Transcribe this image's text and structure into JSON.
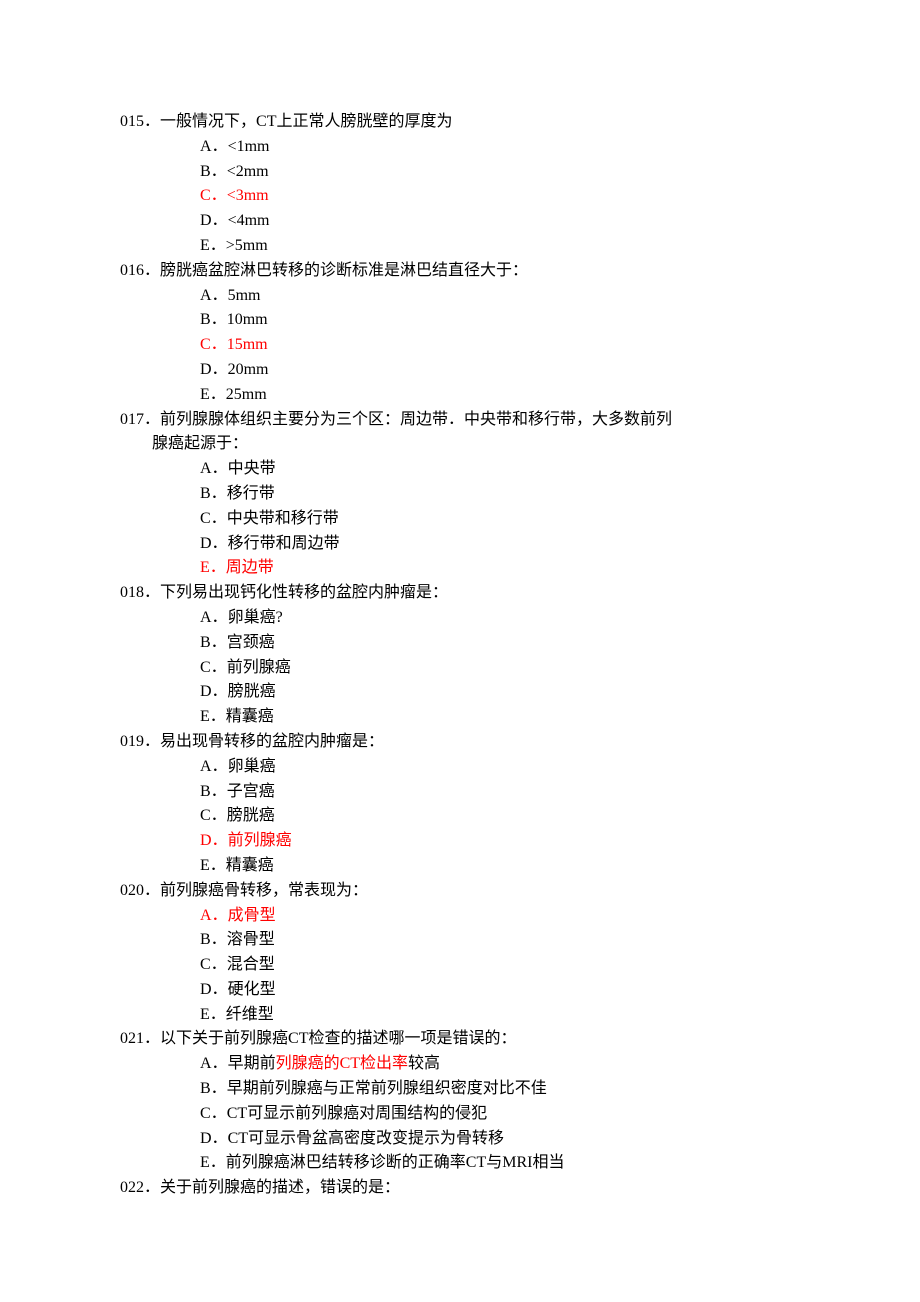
{
  "questions": [
    {
      "num": "015．",
      "text": "一般情况下，CT上正常人膀胱壁的厚度为",
      "options": [
        {
          "label": "A．",
          "text": "<1mm",
          "answer": false
        },
        {
          "label": "B．",
          "text": "<2mm",
          "answer": false
        },
        {
          "label": "C．",
          "text": "<3mm",
          "answer": true
        },
        {
          "label": "D．",
          "text": "<4mm",
          "answer": false
        },
        {
          "label": "E．",
          "text": ">5mm",
          "answer": false
        }
      ]
    },
    {
      "num": "016．",
      "text": "膀胱癌盆腔淋巴转移的诊断标准是淋巴结直径大于：",
      "options": [
        {
          "label": "A．",
          "text": "5mm",
          "answer": false
        },
        {
          "label": "B．",
          "text": "10mm",
          "answer": false
        },
        {
          "label": "C．",
          "text": "15mm",
          "answer": true
        },
        {
          "label": "D．",
          "text": "20mm",
          "answer": false
        },
        {
          "label": "E．",
          "text": "25mm",
          "answer": false
        }
      ]
    },
    {
      "num": "017．",
      "text": "前列腺腺体组织主要分为三个区：周边带．中央带和移行带，大多数前列",
      "text_cont": "腺癌起源于：",
      "options": [
        {
          "label": "A．",
          "text": "中央带",
          "answer": false
        },
        {
          "label": "B．",
          "text": "移行带",
          "answer": false
        },
        {
          "label": "C．",
          "text": "中央带和移行带",
          "answer": false
        },
        {
          "label": "D．",
          "text": "移行带和周边带",
          "answer": false
        },
        {
          "label": "E．",
          "text": "周边带",
          "answer": true
        }
      ]
    },
    {
      "num": "018．",
      "text": "下列易出现钙化性转移的盆腔内肿瘤是：",
      "options": [
        {
          "label": "A．",
          "text": "卵巢癌?",
          "answer": false
        },
        {
          "label": "B．",
          "text": "宫颈癌",
          "answer": false
        },
        {
          "label": "C．",
          "text": "前列腺癌",
          "answer": false
        },
        {
          "label": "D．",
          "text": "膀胱癌",
          "answer": false
        },
        {
          "label": "E．",
          "text": "精囊癌",
          "answer": false
        }
      ]
    },
    {
      "num": "019．",
      "text": "易出现骨转移的盆腔内肿瘤是：",
      "options": [
        {
          "label": "A．",
          "text": "卵巢癌",
          "answer": false
        },
        {
          "label": "B．",
          "text": "子宫癌",
          "answer": false
        },
        {
          "label": "C．",
          "text": "膀胱癌",
          "answer": false
        },
        {
          "label": "D．",
          "text": "前列腺癌",
          "answer": true
        },
        {
          "label": "E．",
          "text": "精囊癌",
          "answer": false
        }
      ]
    },
    {
      "num": "020．",
      "text": "前列腺癌骨转移，常表现为：",
      "options": [
        {
          "label": "A．",
          "text": "成骨型",
          "answer": true
        },
        {
          "label": "B．",
          "text": "溶骨型",
          "answer": false
        },
        {
          "label": "C．",
          "text": "混合型",
          "answer": false
        },
        {
          "label": "D．",
          "text": "硬化型",
          "answer": false
        },
        {
          "label": "E．",
          "text": "纤维型",
          "answer": false
        }
      ]
    },
    {
      "num": "021．",
      "text": "以下关于前列腺癌CT检查的描述哪一项是错误的：",
      "options": [
        {
          "label": "A．",
          "text_pre": "早期前",
          "text_red": "列腺癌的CT检出率",
          "text_post": "较高",
          "partial": true
        },
        {
          "label": "B．",
          "text": "早期前列腺癌与正常前列腺组织密度对比不佳",
          "answer": false
        },
        {
          "label": "C．",
          "text": "CT可显示前列腺癌对周围结构的侵犯",
          "answer": false
        },
        {
          "label": "D．",
          "text": "CT可显示骨盆高密度改变提示为骨转移",
          "answer": false
        },
        {
          "label": "E．",
          "text": "前列腺癌淋巴结转移诊断的正确率CT与MRI相当",
          "answer": false
        }
      ]
    },
    {
      "num": "022．",
      "text": "关于前列腺癌的描述，错误的是：",
      "options": []
    }
  ]
}
